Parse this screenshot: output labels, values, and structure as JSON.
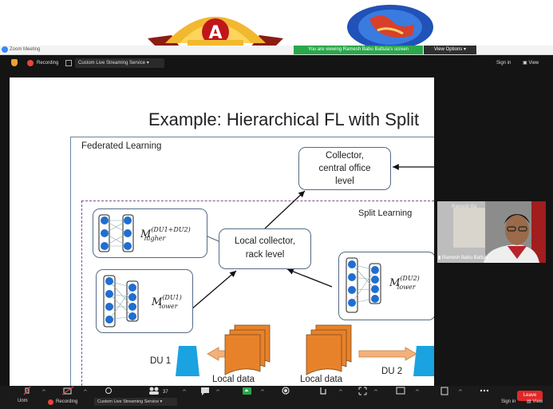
{
  "window": {
    "app_title": "Zoom Meeting",
    "viewing_notice": "You are viewing Ramesh Babu Battula's screen",
    "view_options_label": "View Options"
  },
  "top_bar": {
    "recording_label": "Recording",
    "stream_label": "Custom Live Streaming Service",
    "sign_in_label": "Sign in",
    "view_label": "View"
  },
  "banner": {
    "badge_text": "ACCREDITED WITH GRADE",
    "badge_grade": "A",
    "badge_base": "NAAC"
  },
  "slide": {
    "title": "Example: Hierarchical FL with Split",
    "fl_label": "Federated Learning",
    "sl_label": "Split Learning",
    "collector_line1": "Collector,",
    "collector_line2": "central office",
    "collector_line3": "level",
    "local_collector_line1": "Local collector,",
    "local_collector_line2": "rack level",
    "m_higher_main": "M",
    "m_higher_sup": "(DU1+DU2)",
    "m_higher_sub": "higher",
    "m_lower1_main": "M",
    "m_lower1_sup": "(DU1)",
    "m_lower1_sub": "lower",
    "m_lower2_main": "M",
    "m_lower2_sup": "(DU2)",
    "m_lower2_sub": "lower",
    "du1": "DU 1",
    "du2": "DU 2",
    "local_data_1": "Local data",
    "local_data_2": "Local data"
  },
  "participant": {
    "name": "Ramesh Babu Battula",
    "name_top": "Ramesh Ba"
  },
  "toolbar": {
    "participants_count": "37",
    "leave_label": "Leave",
    "unmute_label": "Unm",
    "recording_label": "Recording",
    "stream_label": "Custom Live Streaming Service",
    "sign_in_label": "Sign in",
    "view_label": "View"
  },
  "colors": {
    "accent_green": "#2aa84a",
    "node_blue": "#1f6fd1",
    "data_orange": "#e8822a",
    "du_cyan": "#1aa3e0",
    "leave_red": "#e02828"
  }
}
